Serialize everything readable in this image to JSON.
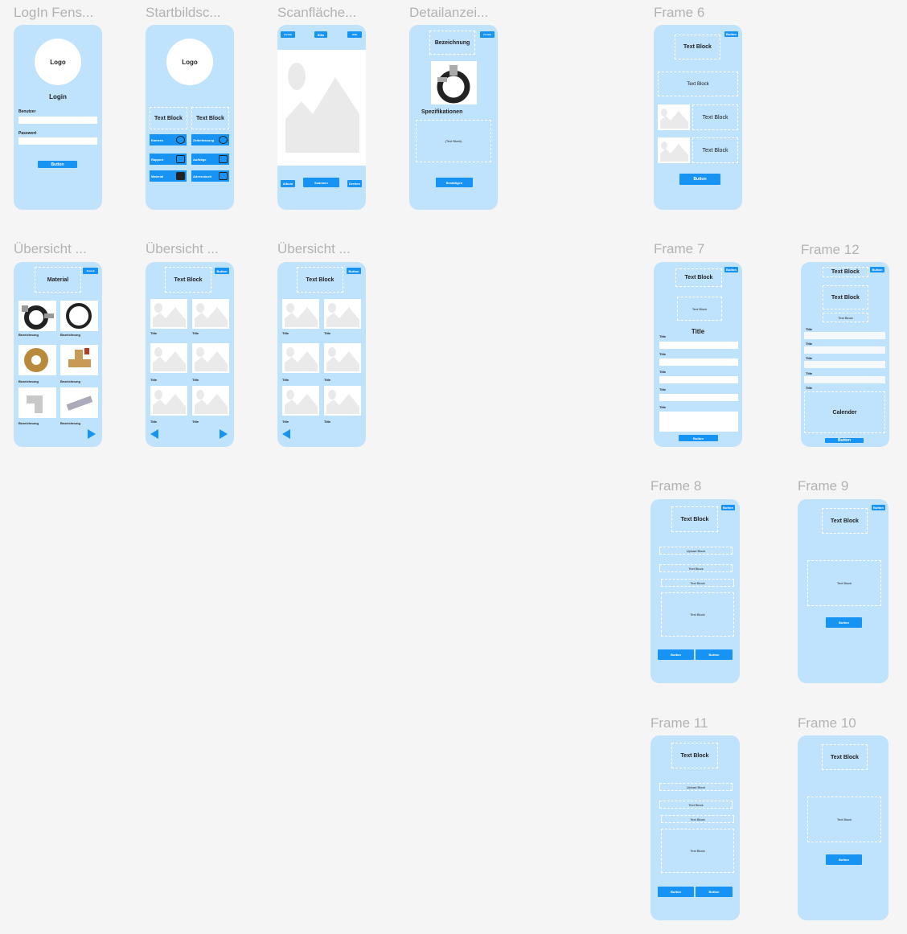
{
  "labels": {
    "login": "LogIn Fens...",
    "start": "Startbildsc...",
    "scan": "Scanfläche...",
    "detail": "Detailanzei...",
    "f6": "Frame 6",
    "ov1": "Übersicht ...",
    "ov2": "Übersicht ...",
    "ov3": "Übersicht ...",
    "f7": "Frame 7",
    "f12": "Frame 12",
    "f8": "Frame 8",
    "f9": "Frame 9",
    "f11": "Frame 11",
    "f10": "Frame 10"
  },
  "login": {
    "logo": "Logo",
    "title": "Login",
    "user": "Benutzer",
    "pass": "Passwort",
    "button": "Button"
  },
  "start": {
    "logo": "Logo",
    "tb1": "Text Block",
    "tb2": "Text Block",
    "menu": [
      "Kamera",
      "Zeiterfassung",
      "Rapport",
      "Aufträge",
      "Material",
      "Adressbuch"
    ]
  },
  "scan": {
    "top_left": "Zurück",
    "top_mid": "Blitz",
    "top_right": "Hilfe",
    "album": "Album",
    "scan": "Scannen",
    "drehen": "Drehen"
  },
  "detail": {
    "top": "Zurück",
    "title": "Bezeichnung",
    "spec": "Spezifikationen",
    "block": "(Text Block)",
    "confirm": "Bestätigen"
  },
  "f6": {
    "button_top": "Button",
    "tb1": "Text Block",
    "tb2": "Text Block",
    "tb3": "Text Block",
    "tb4": "Text Block",
    "button": "Button"
  },
  "ov1": {
    "top": "Zurück",
    "title": "Material",
    "items": [
      "Bezeichnung",
      "Bezeichnung",
      "Bezeichnung",
      "Bezeichnung",
      "Bezeichnung",
      "Bezeichnung"
    ]
  },
  "ov2": {
    "top": "Button",
    "title": "Text Block",
    "items": [
      "Title",
      "Title",
      "Title",
      "Title",
      "Title",
      "Title"
    ]
  },
  "ov3": {
    "top": "Button",
    "title": "Text Block",
    "items": [
      "Title",
      "Title",
      "Title",
      "Title",
      "Title",
      "Title"
    ]
  },
  "f7": {
    "top": "Button",
    "tb1": "Text Block",
    "tb2": "Text Block",
    "title": "Title",
    "fields": [
      "Title",
      "Title",
      "Title",
      "Title",
      "Title"
    ],
    "button": "Button"
  },
  "f12": {
    "top": "Button",
    "tb1": "Text Block",
    "tb2": "Text Block",
    "tb3": "Text Block",
    "fields": [
      "Title",
      "Title",
      "Title",
      "Title",
      "Title"
    ],
    "calendar": "Calender",
    "button": "Button"
  },
  "f8": {
    "top": "Button",
    "tb": "Text Block",
    "upload": "Upload Block",
    "tb2": "Text Block",
    "tb3": "Text Block",
    "tb4": "Text Block",
    "b1": "Button",
    "b2": "Button"
  },
  "f9": {
    "top": "Button",
    "tb": "Text Block",
    "tb2": "Text Block",
    "button": "Button"
  },
  "f11": {
    "tb": "Text Block",
    "upload": "Upload Block",
    "tb2": "Text Block",
    "tb3": "Text Block",
    "tb4": "Text Block",
    "b1": "Button",
    "b2": "Button"
  },
  "f10": {
    "tb": "Text Block",
    "tb2": "Text Block",
    "button": "Button"
  }
}
